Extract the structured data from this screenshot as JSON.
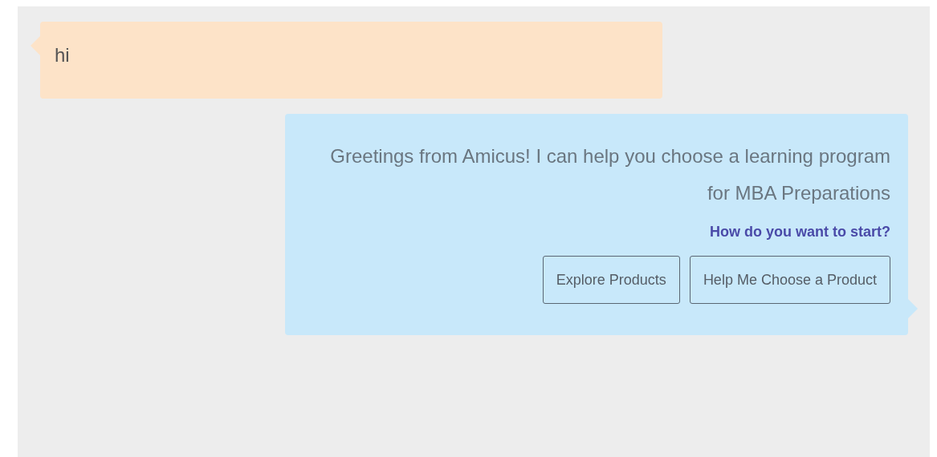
{
  "messages": [
    {
      "kind": "user",
      "text": "hi"
    },
    {
      "kind": "bot",
      "text": "Greetings from Amicus! I can help you choose a learning program for MBA Preparations",
      "prompt": "How do you want to start?",
      "options": [
        "Explore Products",
        "Help Me Choose a Product"
      ]
    }
  ]
}
